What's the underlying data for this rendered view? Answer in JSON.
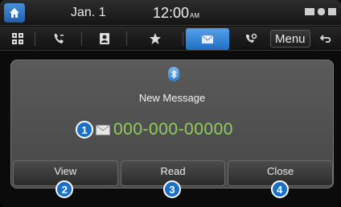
{
  "statusbar": {
    "date": "Jan.  1",
    "time": "12:00",
    "ampm": "AM"
  },
  "toolbar": {
    "items": [
      {
        "icon": "dialpad-icon"
      },
      {
        "icon": "call-log-icon"
      },
      {
        "icon": "contacts-icon"
      },
      {
        "icon": "favorites-star-icon"
      },
      {
        "icon": "messages-envelope-icon",
        "active": true
      },
      {
        "icon": "phone-settings-icon"
      }
    ],
    "menu_label": "Menu",
    "back_icon": "back-arrow-icon"
  },
  "popup": {
    "title": "New Message",
    "number": "000-000-00000",
    "buttons": {
      "view": "View",
      "read": "Read",
      "close": "Close"
    }
  },
  "callouts": [
    "1",
    "2",
    "3",
    "4"
  ],
  "colors": {
    "accent": "#1a6fc6",
    "number_green": "#8fd05a"
  }
}
